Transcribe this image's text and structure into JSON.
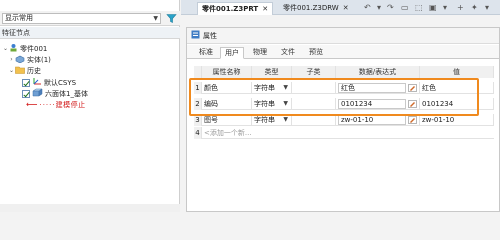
{
  "left_panel": {
    "filter_value": "显示常用",
    "tree_header": "特征节点",
    "nodes": [
      {
        "label": "零件001"
      },
      {
        "label": "实体(1)"
      },
      {
        "label": "历史"
      },
      {
        "label": "默认CSYS"
      },
      {
        "label": "六面体1_基体"
      },
      {
        "label": "建模停止"
      }
    ]
  },
  "doc_tabs": [
    {
      "label": "零件001.Z3PRT",
      "close": "✕"
    },
    {
      "label": "零件001.Z3DRW",
      "close": "✕"
    }
  ],
  "panel": {
    "title": "属性",
    "tabs": [
      "标准",
      "用户",
      "物理",
      "文件",
      "预览"
    ],
    "active_tab": "用户",
    "columns": [
      "属性名称",
      "类型",
      "子类",
      "数据/表达式",
      "值"
    ],
    "rows": [
      {
        "num": "1",
        "name": "颜色",
        "type": "字符串",
        "sub": "",
        "expr": "红色",
        "value": "红色"
      },
      {
        "num": "2",
        "name": "编码",
        "type": "字符串",
        "sub": "",
        "expr": "0101234",
        "value": "0101234"
      },
      {
        "num": "3",
        "name": "图号",
        "type": "字符串",
        "sub": "",
        "expr": "zw-01-10",
        "value": "zw-01-10"
      }
    ],
    "new_row": {
      "num": "4",
      "placeholder": "<添加一个新..."
    }
  },
  "colors": {
    "highlight": "#f08a1e",
    "stop": "#d01010"
  }
}
